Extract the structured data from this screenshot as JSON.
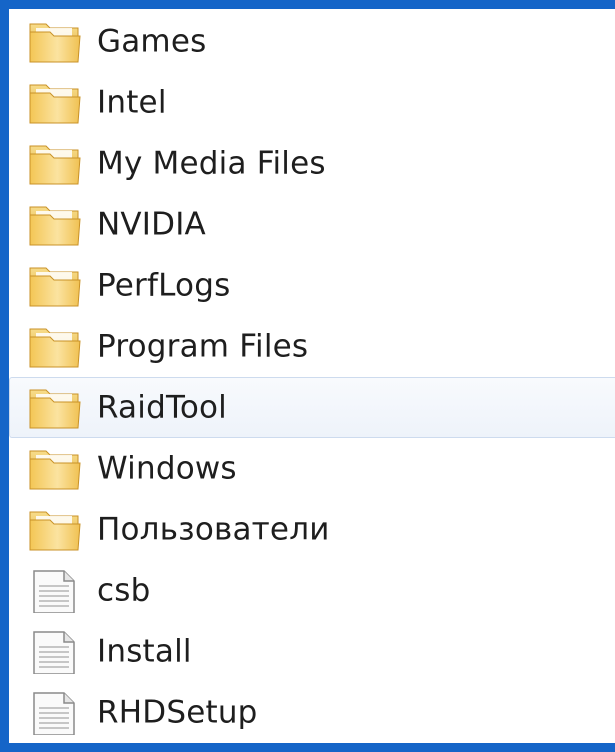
{
  "colors": {
    "background": "#1565c8",
    "panel": "#ffffff",
    "text": "#1e1e1e",
    "folder": "#f0c65a",
    "hover_border": "#cddbee"
  },
  "items": [
    {
      "name": "Games",
      "type": "folder",
      "icon": "folder-icon"
    },
    {
      "name": "Intel",
      "type": "folder",
      "icon": "folder-icon"
    },
    {
      "name": "My Media Files",
      "type": "folder",
      "icon": "folder-icon"
    },
    {
      "name": "NVIDIA",
      "type": "folder",
      "icon": "folder-icon"
    },
    {
      "name": "PerfLogs",
      "type": "folder",
      "icon": "folder-icon"
    },
    {
      "name": "Program Files",
      "type": "folder",
      "icon": "folder-icon"
    },
    {
      "name": "RaidTool",
      "type": "folder",
      "icon": "folder-icon",
      "hovered": true
    },
    {
      "name": "Windows",
      "type": "folder",
      "icon": "folder-icon"
    },
    {
      "name": "Пользователи",
      "type": "folder",
      "icon": "folder-icon"
    },
    {
      "name": "csb",
      "type": "file",
      "icon": "document-icon"
    },
    {
      "name": "Install",
      "type": "file",
      "icon": "document-icon"
    },
    {
      "name": "RHDSetup",
      "type": "file",
      "icon": "document-icon"
    }
  ]
}
